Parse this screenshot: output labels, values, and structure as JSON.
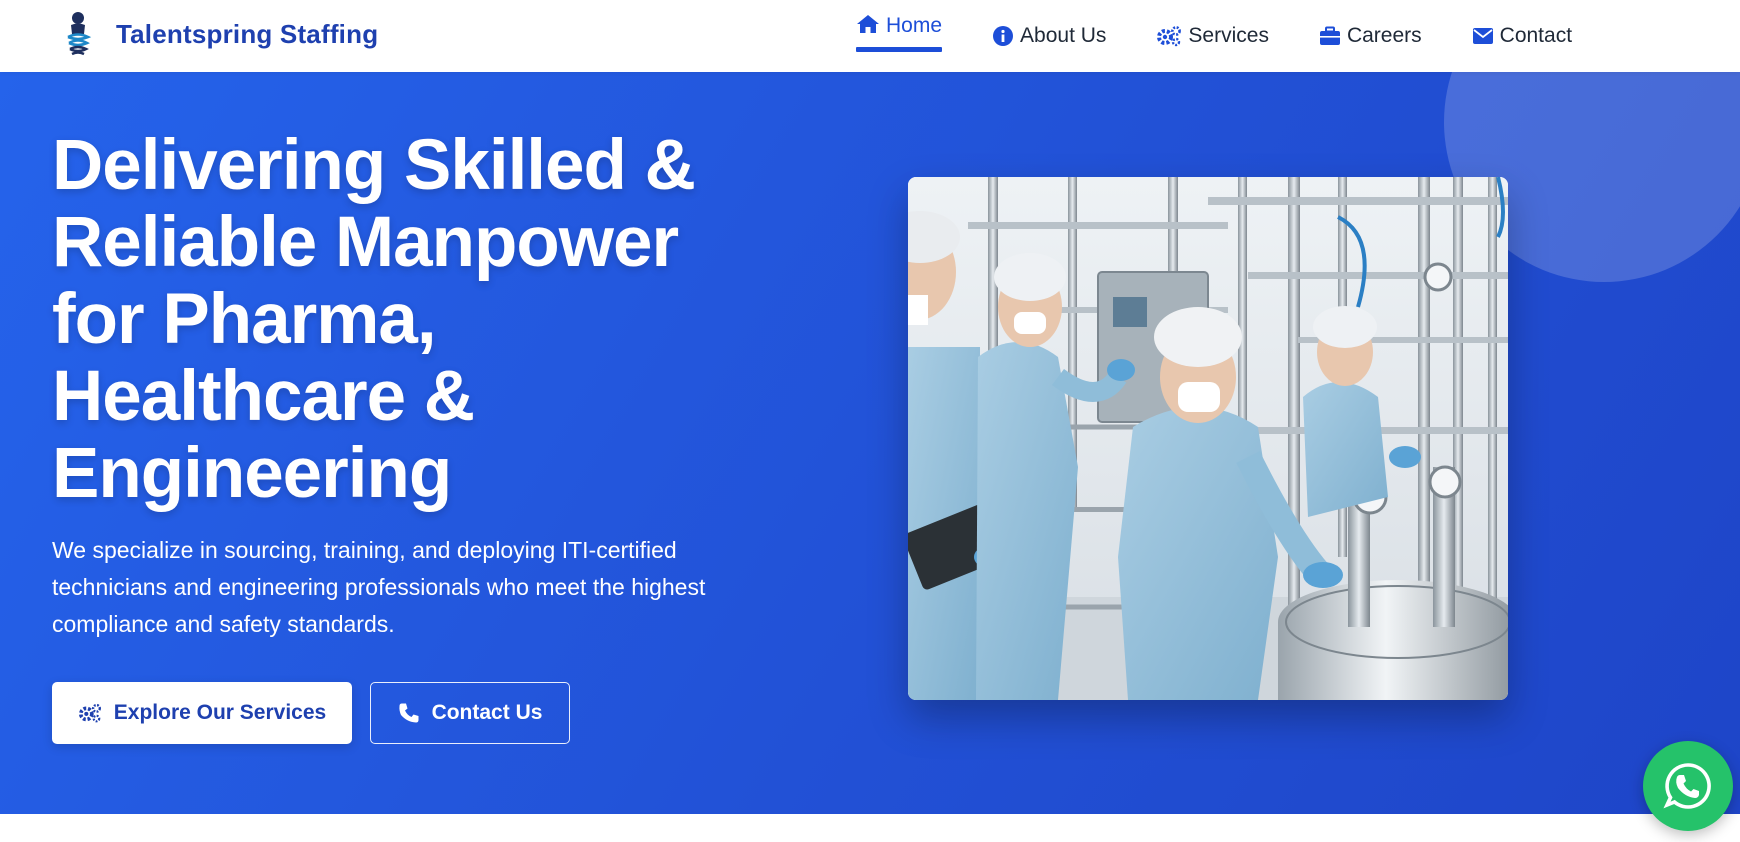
{
  "brand": {
    "name": "Talentspring Staffing",
    "logo_icon": "person-spring-logo-icon"
  },
  "nav": {
    "items": [
      {
        "label": "Home",
        "icon": "home-icon",
        "active": true
      },
      {
        "label": "About Us",
        "icon": "info-icon",
        "active": false
      },
      {
        "label": "Services",
        "icon": "gears-icon",
        "active": false
      },
      {
        "label": "Careers",
        "icon": "briefcase-icon",
        "active": false
      },
      {
        "label": "Contact",
        "icon": "envelope-icon",
        "active": false
      }
    ]
  },
  "hero": {
    "title": "Delivering Skilled & Reliable Manpower for Pharma, Healthcare & Engineering",
    "subtitle": "We specialize in sourcing, training, and deploying ITI-certified technicians and engineering professionals who meet the highest compliance and safety standards.",
    "primary_button": {
      "label": "Explore Our Services",
      "icon": "gears-icon"
    },
    "secondary_button": {
      "label": "Contact Us",
      "icon": "phone-icon"
    },
    "image_icon": "pharma-technicians-photo"
  },
  "floating": {
    "icon": "whatsapp-icon"
  },
  "colors": {
    "accent": "#1d4ed8",
    "hero_bg": "#2251d6",
    "whatsapp": "#25c26a",
    "text_dark": "#1f2937"
  }
}
